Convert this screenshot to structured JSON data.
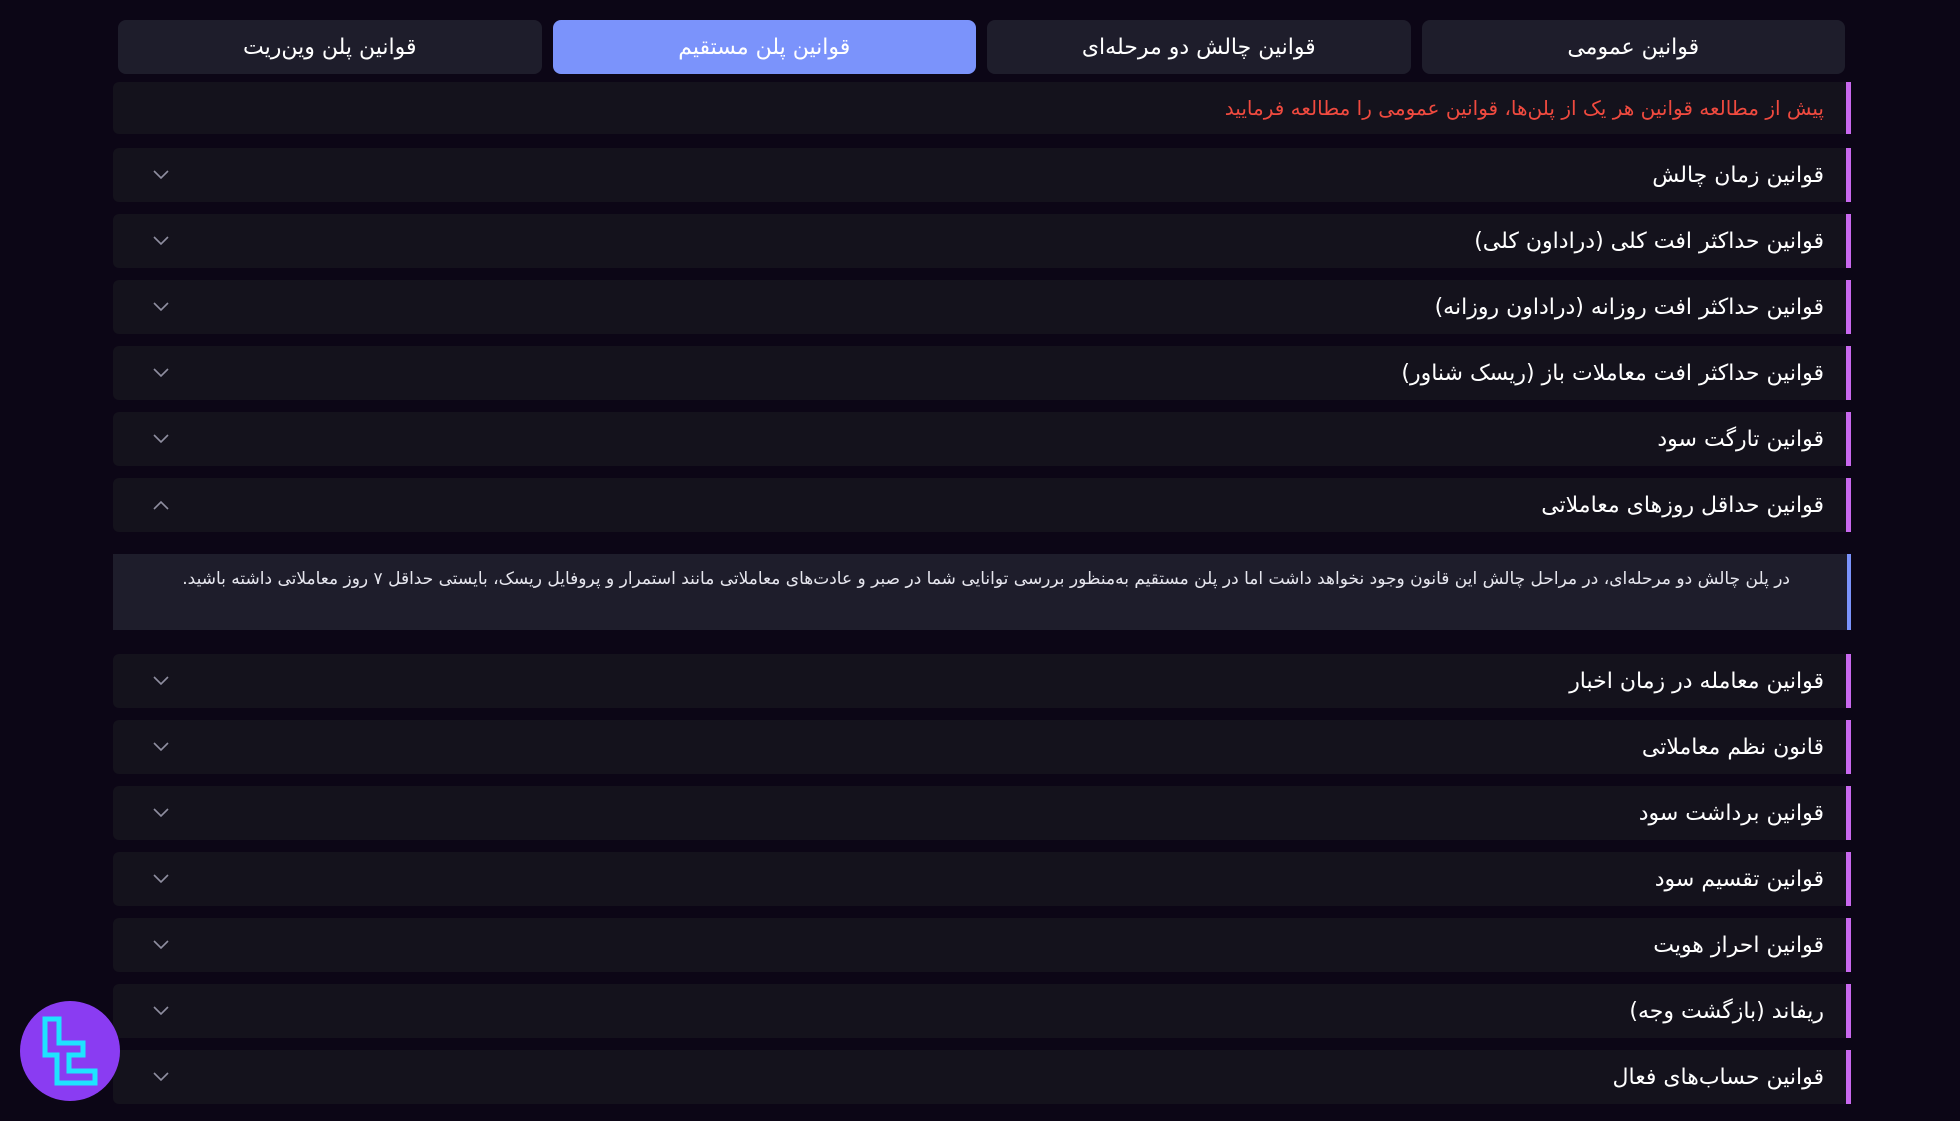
{
  "tabs": [
    {
      "label": "قوانین عمومی",
      "active": false
    },
    {
      "label": "قوانین چالش دو مرحله‌ای",
      "active": false
    },
    {
      "label": "قوانین پلن مستقیم",
      "active": true
    },
    {
      "label": "قوانین پلن وین‌ریت",
      "active": false
    }
  ],
  "notice": "پیش از مطالعه قوانین هر یک از پلن‌ها، قوانین عمومی را مطالعه فرمایید",
  "accordion": [
    {
      "title": "قوانین زمان چالش",
      "expanded": false
    },
    {
      "title": "قوانین حداکثر افت کلی (دراداون کلی)",
      "expanded": false
    },
    {
      "title": "قوانین حداکثر افت روزانه (دراداون روزانه)",
      "expanded": false
    },
    {
      "title": "قوانین حداکثر افت معاملات باز (ریسک شناور)",
      "expanded": false
    },
    {
      "title": "قوانین تارگت سود",
      "expanded": false
    },
    {
      "title": "قوانین حداقل روزهای معاملاتی",
      "expanded": true,
      "content": "در پلن چالش دو مرحله‌ای، در مراحل چالش این قانون وجود نخواهد داشت اما در پلن مستقیم به‌منظور بررسی توانایی شما در صبر و عادت‌های معاملاتی مانند استمرار و پروفایل ریسک، بایستی حداقل ۷ روز معاملاتی داشته باشید."
    },
    {
      "title": "قوانین معامله در زمان اخبار",
      "expanded": false
    },
    {
      "title": "قانون نظم معاملاتی",
      "expanded": false
    },
    {
      "title": "قوانین برداشت سود",
      "expanded": false
    },
    {
      "title": "قوانین تقسیم سود",
      "expanded": false
    },
    {
      "title": "قوانین احراز هویت",
      "expanded": false
    },
    {
      "title": "ریفاند (بازگشت وجه)",
      "expanded": false
    },
    {
      "title": "قوانین حساب‌های فعال",
      "expanded": false
    }
  ],
  "icons": {
    "collapsed": "chevron-down-icon",
    "expanded": "chevron-up-icon",
    "logo": "brand-logo-icon"
  },
  "colors": {
    "background": "#0c0616",
    "tab_active": "#7b93fb",
    "accent_border": "#c968ee",
    "notice_text": "#f04a3f",
    "logo_bg": "#8a3cf2",
    "logo_fg": "#1ee3ff"
  }
}
